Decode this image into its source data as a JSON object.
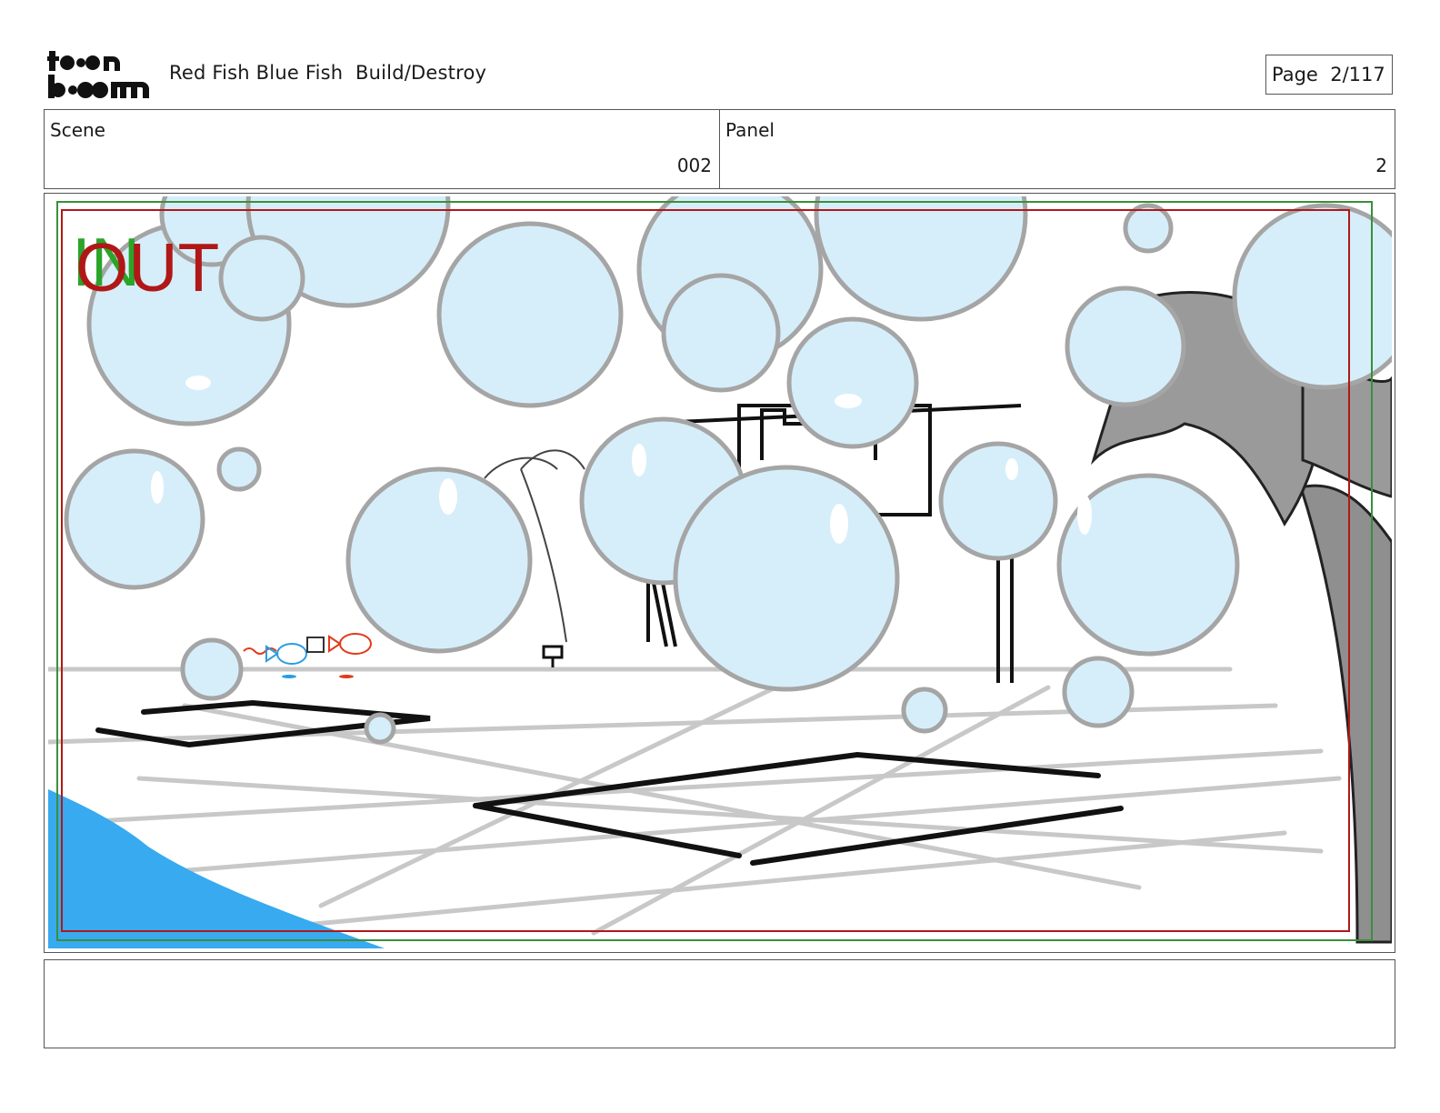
{
  "header": {
    "logo_text": "toonboom",
    "title": "Red Fish Blue Fish  Build/Destroy",
    "page_label": "Page",
    "page_value": "2/117"
  },
  "info": {
    "scene_label": "Scene",
    "scene_value": "002",
    "panel_label": "Panel",
    "panel_value": "2"
  },
  "image": {
    "description": "storyboard sketch",
    "in_marker": "IN",
    "out_marker": "OUT",
    "safe_area_green": "#3a8f3a",
    "safe_area_red": "#b01818",
    "bubble_fill": "#d6eefa",
    "bubble_stroke": "#a5a5a5",
    "water_color": "#37aaf0",
    "palm_color": "#8f8f8f"
  },
  "notes": {
    "text": ""
  }
}
